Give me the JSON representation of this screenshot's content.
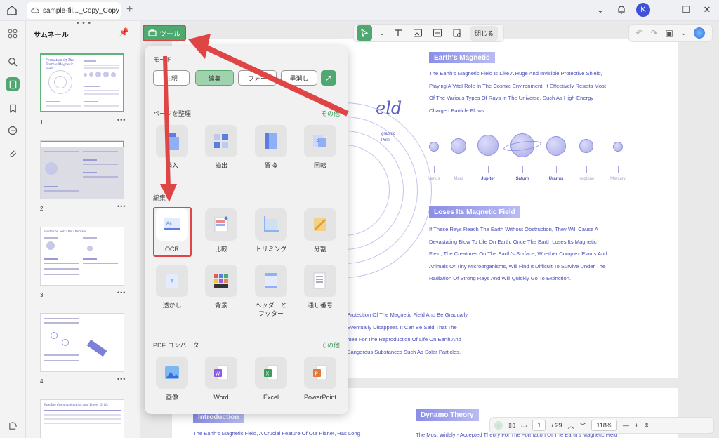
{
  "window": {
    "tab_title": "sample-fil..._Copy_Copy",
    "avatar_letter": "K",
    "accent": "#4ea870"
  },
  "thumbs": {
    "title": "サムネール",
    "pages": [
      {
        "number": "1"
      },
      {
        "number": "2"
      },
      {
        "number": "3"
      },
      {
        "number": "4"
      }
    ],
    "page1_title": "Formation Of The Earth's Magnetic Field",
    "page3_title": "Evidence For The Theories",
    "page5_title": "Satellite Communications And Power Grids"
  },
  "toolbar": {
    "tools_label": "ツール",
    "close_label": "閉じる"
  },
  "panel": {
    "mode_heading": "モード",
    "modes": [
      "注釈",
      "編集",
      "フォー",
      "墨消し"
    ],
    "organize_heading": "ページを整理",
    "organize_more": "その他",
    "organize_tools": [
      "挿入",
      "抽出",
      "置換",
      "回転"
    ],
    "edit_heading": "編集",
    "edit_tools_row1": [
      "OCR",
      "比較",
      "トリミング",
      "分割"
    ],
    "edit_tools_row2": [
      "透かし",
      "背景",
      "ヘッダーと\nフッター",
      "通し番号"
    ],
    "converter_heading": "PDF コンバーター",
    "converter_more": "その他",
    "converter_tools": [
      "画像",
      "Word",
      "Excel",
      "PowerPoint"
    ]
  },
  "document": {
    "title_fragment": "eld",
    "h1": "Earth's Magnetic",
    "p1": [
      "The Earth's Magnetic Field Is Like A Huge And Invisible Protective Shield,",
      "Playing A Vital Role In The Cosmic Environment. It Effectively Resists Most",
      "Of The Various Types Of Rays In The Universe, Such As High-Energy",
      "Charged Particle Flows."
    ],
    "planets": [
      "Venus",
      "Mars",
      "Jupiter",
      "Saturn",
      "Uranus",
      "Neptune",
      "Mercury"
    ],
    "h2": "Loses Its Magnetic Field",
    "p2": [
      "If These Rays Reach The Earth Without Obstruction, They Will Cause A",
      "Devastating Blow To Life On Earth. Once The Earth Loses Its Magnetic",
      "Field, The Creatures On The Earth's Surface, Whether Complex Plants And",
      "Animals Or Tiny Microorganisms, Will Find It Difficult To Survive Under The",
      "Radiation Of Strong Rays And Will Quickly Go To Extinction."
    ],
    "p3": [
      "Protection Of The Magnetic Field And Be Gradually",
      "Eventually Disappear. It Can Be Said That The",
      "ntee For The Reproduction Of Life On Earth And",
      "Dangerous Substances Such As Solar Particles."
    ],
    "graphic_label": [
      "graphic",
      "Pole"
    ],
    "intro_tag": "Introduction",
    "intro_text": "The Earth's Magnetic Field, A Crucial Feature Of Our Planet, Has Long",
    "dynamo_tag": "Dynamo Theory",
    "dynamo_text": "The Most Widely - Accepted Theory For The Formation Of The Earth's Magnetic Field"
  },
  "bottom": {
    "page_current": "1",
    "page_total": "/ 29",
    "zoom": "118%"
  }
}
